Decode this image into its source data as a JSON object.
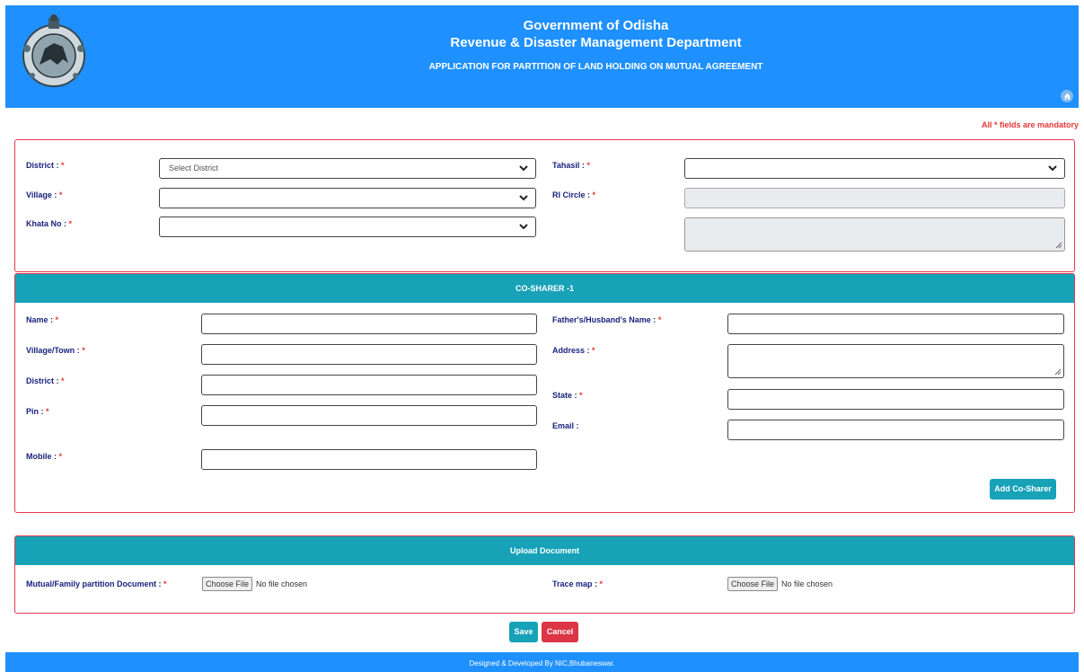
{
  "header": {
    "line1": "Government of Odisha",
    "line2": "Revenue & Disaster Management Department",
    "line3": "APPLICATION FOR PARTITION OF LAND HOLDING ON MUTUAL AGREEMENT",
    "logo": "odisha-emblem",
    "home_icon": "home-icon"
  },
  "note": "All * fields are mandatory",
  "location": {
    "district_label": "District : ",
    "district_placeholder": "Select District",
    "tahasil_label": "Tahasil : ",
    "village_label": "Village : ",
    "ri_circle_label": "RI Circle : ",
    "khata_label": "Khata No : ",
    "required_mark": "*"
  },
  "co_sharer": {
    "title": "CO-SHARER -1",
    "name_label": "Name : ",
    "father_label": "Father's/Husband's Name : ",
    "village_label": "Village/Town : ",
    "address_label": "Address : ",
    "district_label": "District : ",
    "state_label": "State : ",
    "pin_label": "Pin : ",
    "email_label": "Email :",
    "mobile_label": "Mobile : ",
    "add_button": "Add Co-Sharer"
  },
  "upload": {
    "title": "Upload Document",
    "doc_label": "Mutual/Family partition Document : ",
    "trace_label": "Trace map : ",
    "choose_file": "Choose File",
    "no_file": "No file chosen"
  },
  "actions": {
    "save": "Save",
    "cancel": "Cancel"
  },
  "footer": "Designed & Developed By NIC,Bhubaneswar.",
  "colors": {
    "header": "#1e90ff",
    "panel_head": "#17a2b8",
    "panel_border": "#e53950",
    "required": "#e53935",
    "cancel": "#dc3545"
  }
}
